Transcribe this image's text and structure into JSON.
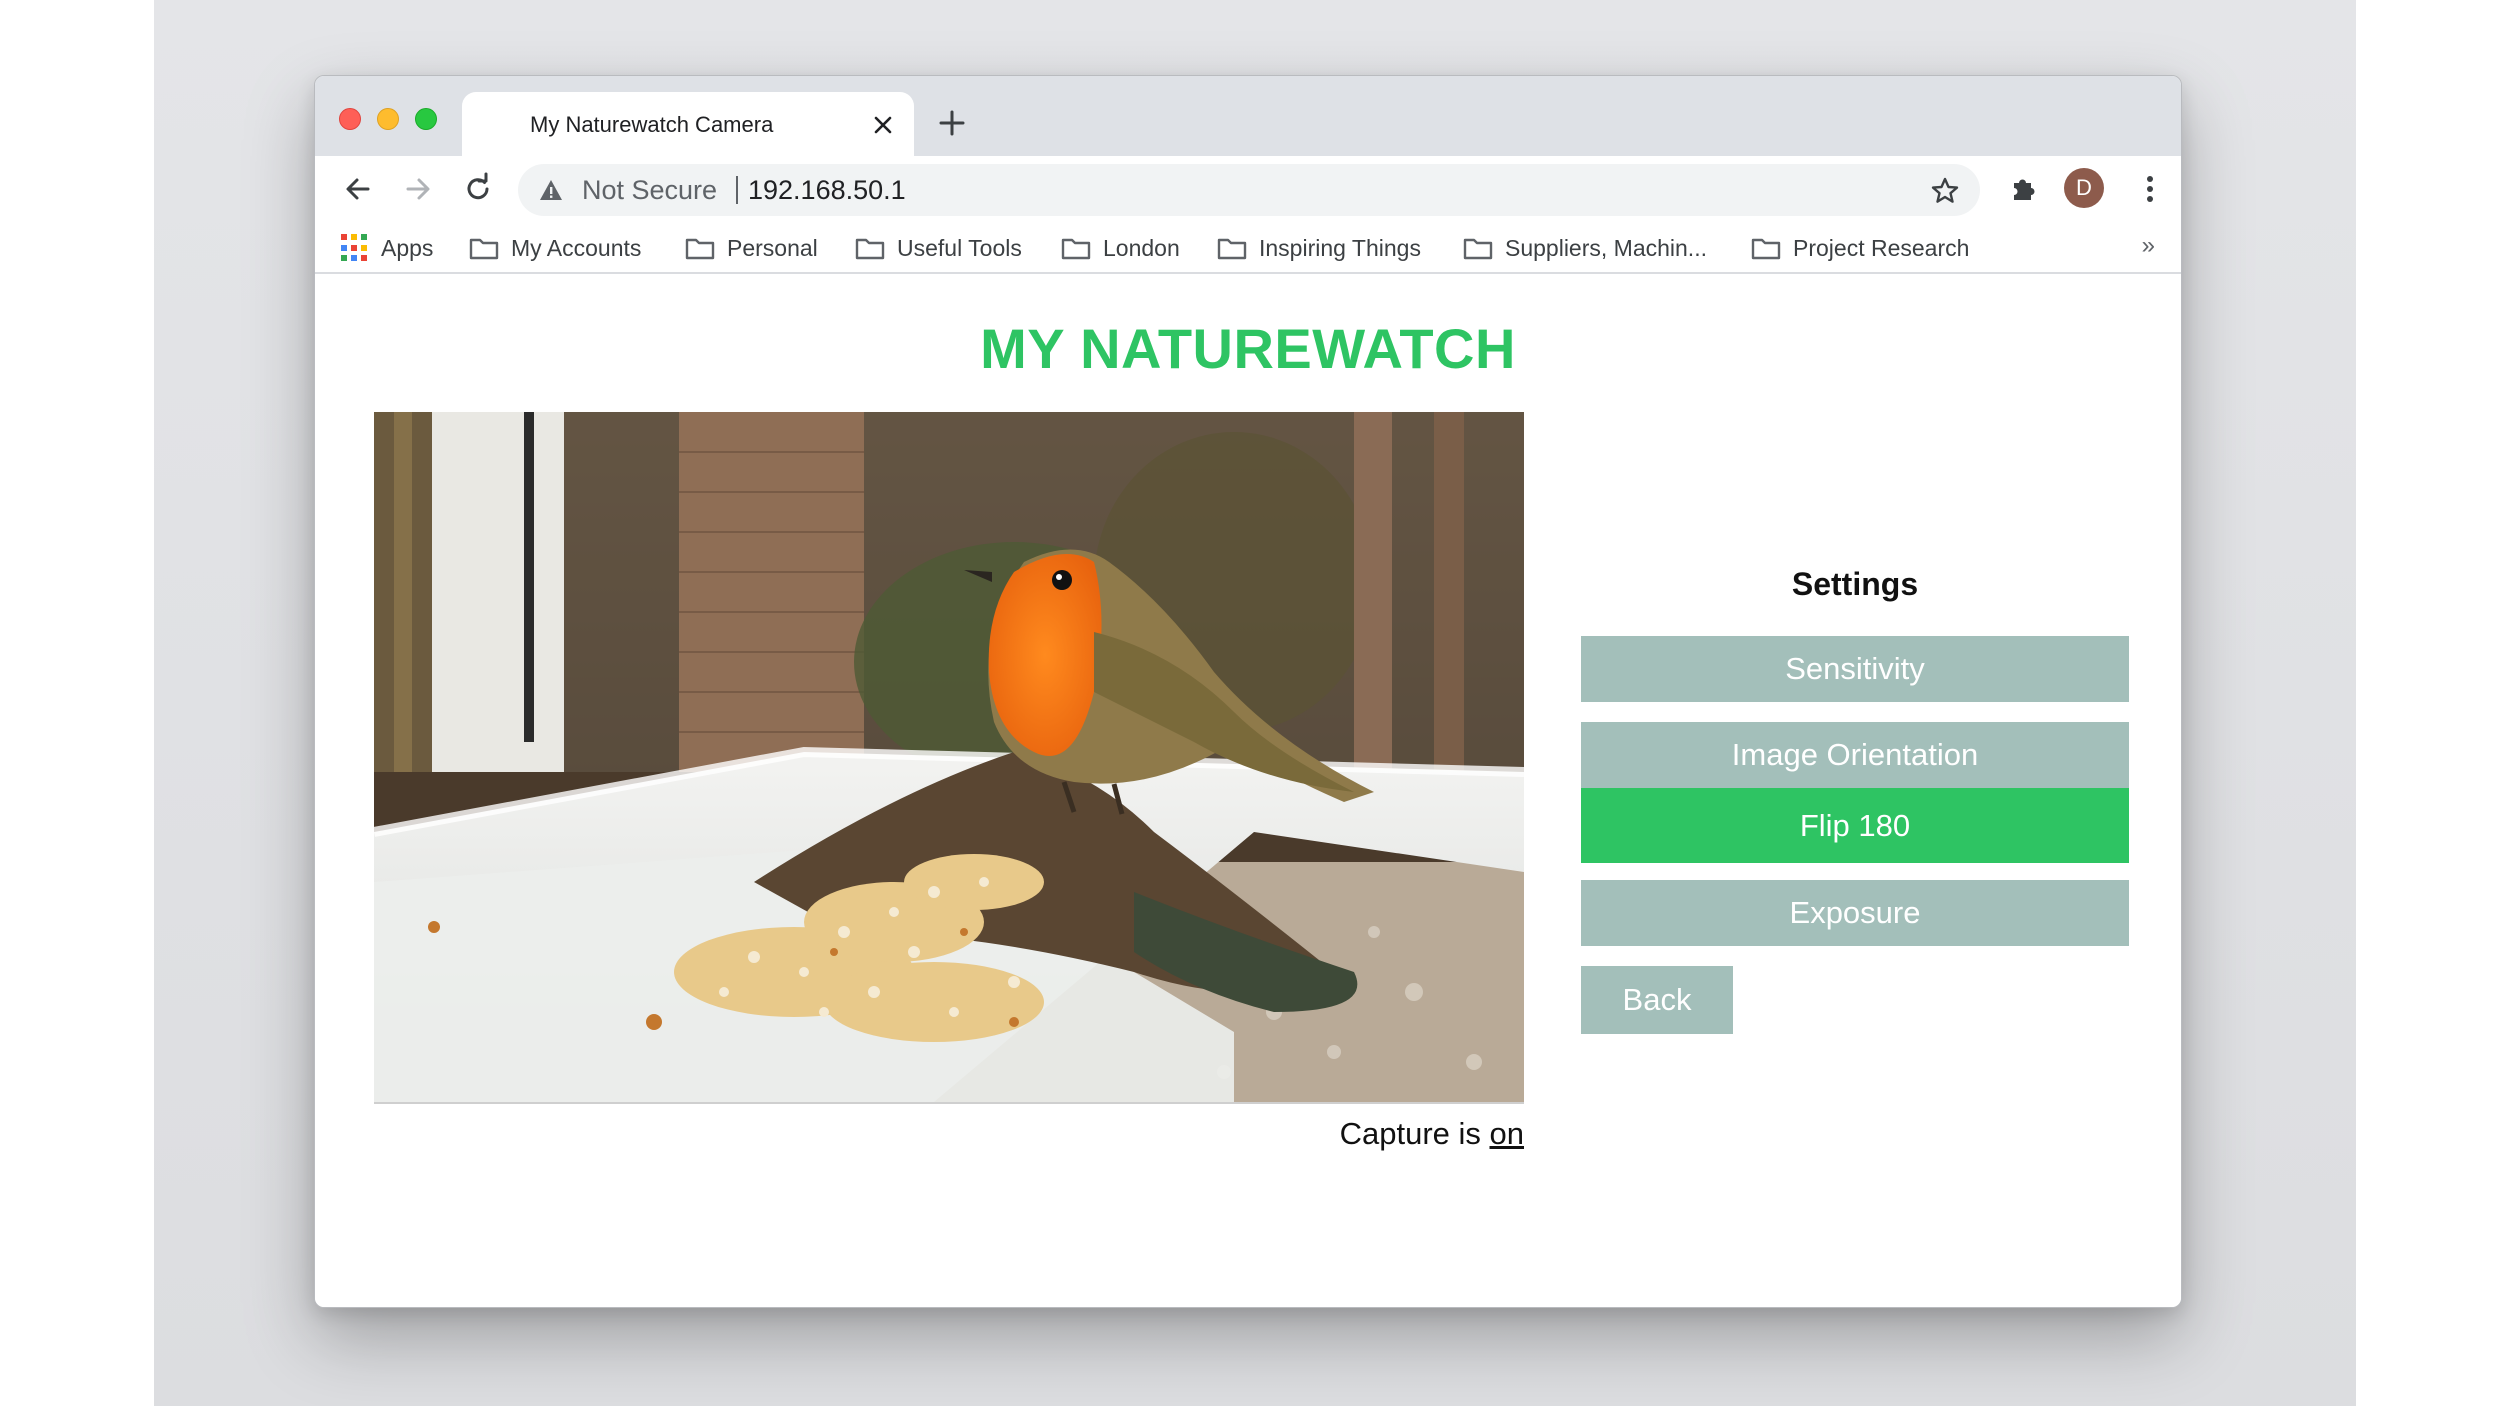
{
  "browser": {
    "tab_title": "My Naturewatch Camera",
    "security_label": "Not Secure",
    "url": "192.168.50.1",
    "profile_initial": "D",
    "bookmarks": [
      {
        "label": "Apps",
        "icon": "apps-grid-icon"
      },
      {
        "label": "My Accounts",
        "icon": "folder-icon"
      },
      {
        "label": "Personal",
        "icon": "folder-icon"
      },
      {
        "label": "Useful Tools",
        "icon": "folder-icon"
      },
      {
        "label": "London",
        "icon": "folder-icon"
      },
      {
        "label": "Inspiring Things",
        "icon": "folder-icon"
      },
      {
        "label": "Suppliers, Machin...",
        "icon": "folder-icon"
      },
      {
        "label": "Project Research",
        "icon": "folder-icon"
      }
    ],
    "bookmarks_overflow": "»"
  },
  "page": {
    "title": "MY NATUREWATCH",
    "capture_prefix": "Capture is",
    "capture_state": "on",
    "camera_feed_subject": "robin on bird feeder"
  },
  "settings": {
    "title": "Settings",
    "sensitivity_label": "Sensitivity",
    "image_orientation_label": "Image Orientation",
    "flip_label": "Flip 180",
    "exposure_label": "Exposure",
    "back_label": "Back"
  },
  "colors": {
    "accent_green": "#2ec463",
    "button_grey": "#a3bfba"
  }
}
